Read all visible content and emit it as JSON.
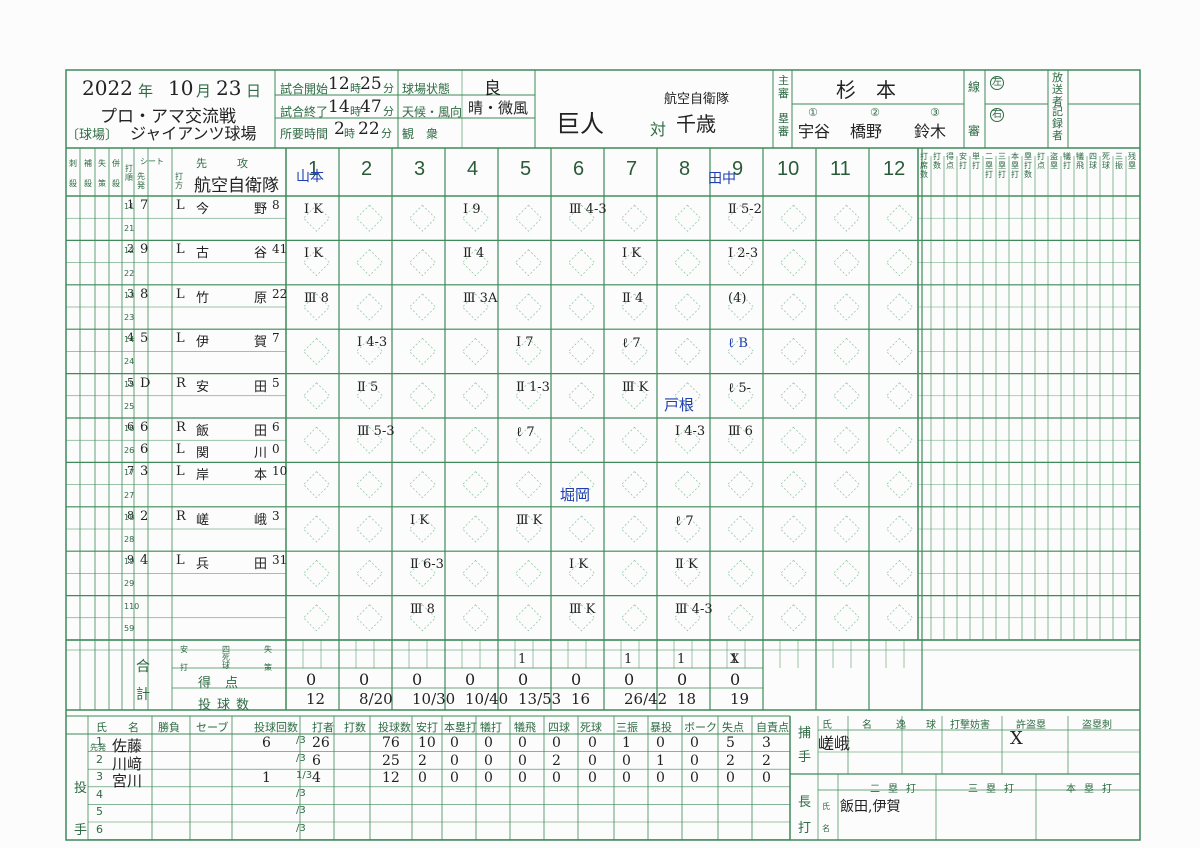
{
  "header": {
    "year": "2022",
    "year_unit": "年",
    "month": "10",
    "month_unit": "月",
    "day": "23",
    "day_unit": "日",
    "game_name": "プロ・アマ交流戦",
    "stadium_label": "〔球場〕",
    "stadium": "ジャイアンツ球場",
    "start_label": "試合開始",
    "start_h": "12",
    "hour_unit": "時",
    "start_m": "25",
    "min_unit": "分",
    "end_label": "試合終了",
    "end_h": "14",
    "end_m": "47",
    "dur_label": "所要時間",
    "dur_h": "2",
    "dur_m": "22",
    "field_cond_label": "球場状態",
    "field_cond": "良",
    "weather_label": "天候・風向",
    "weather": "晴・微風",
    "spectators_label": "観　衆",
    "home_team": "巨人",
    "vs": "対",
    "away_team": "千歳",
    "away_org": "航空自衛隊",
    "plate_ump_label": "主審",
    "plate_ump": "杉本",
    "base_ump_label": "塁審",
    "base_umps": [
      "宇谷",
      "橋野",
      "鈴木"
    ],
    "base_nums": [
      "①",
      "②",
      "③"
    ],
    "line_label": "線",
    "left": "左",
    "right": "右",
    "ump_label": "審",
    "broadcaster_label": "放送者",
    "recorder_label": "記録者"
  },
  "columns": {
    "stat_heads": [
      "刺",
      "補",
      "失",
      "併"
    ],
    "stat_heads2": [
      "殺",
      "殺",
      "策",
      "殺"
    ],
    "order_label": "打順",
    "seat_label": "シート",
    "seat_sub": [
      "先発"
    ],
    "team_label": "先攻",
    "batting_label": "打方",
    "right_heads": [
      "打席数",
      "打数",
      "得点",
      "安打",
      "単打",
      "二塁打",
      "三塁打",
      "本塁打",
      "塁打数",
      "打点",
      "盗塁",
      "犠打",
      "犠飛",
      "四球",
      "死球",
      "三振",
      "残塁"
    ],
    "innings": [
      "1",
      "2",
      "3",
      "4",
      "5",
      "6",
      "7",
      "8",
      "9",
      "10",
      "11",
      "12"
    ]
  },
  "lineup": [
    {
      "order": "1",
      "pos": "7",
      "bats": "L",
      "name": "今野",
      "num": "8"
    },
    {
      "order": "2",
      "pos": "9",
      "bats": "L",
      "name": "古谷",
      "num": "41"
    },
    {
      "order": "3",
      "pos": "8",
      "bats": "L",
      "name": "竹原",
      "num": "22"
    },
    {
      "order": "4",
      "pos": "5",
      "bats": "L",
      "name": "伊賀",
      "num": "7"
    },
    {
      "order": "5",
      "pos": "D",
      "bats": "R",
      "name": "安田",
      "num": "5"
    },
    {
      "order": "6",
      "pos": "6",
      "bats": "R",
      "name": "飯田",
      "num": "6"
    },
    {
      "order": "",
      "pos": "6",
      "bats": "L",
      "name": "関川",
      "num": "0"
    },
    {
      "order": "7",
      "pos": "3",
      "bats": "L",
      "name": "岸本",
      "num": "10"
    },
    {
      "order": "8",
      "pos": "2",
      "bats": "R",
      "name": "嵯峨",
      "num": "3"
    },
    {
      "order": "9",
      "pos": "4",
      "bats": "L",
      "name": "兵田",
      "num": "31"
    }
  ],
  "sub_rows": [
    "11",
    "21",
    "12",
    "22",
    "13",
    "23",
    "14",
    "24",
    "15",
    "25",
    "16",
    "26",
    "17",
    "27",
    "18",
    "28",
    "19",
    "29",
    "59"
  ],
  "pitcher_changes": [
    {
      "label": "山本",
      "inning": "1"
    },
    {
      "label": "田中",
      "inning": "9"
    },
    {
      "label": "戸根",
      "inning": "8"
    },
    {
      "label": "堀岡",
      "inning": "6"
    }
  ],
  "plays": [
    {
      "inn": 1,
      "row": 0,
      "text": "Ⅰ K"
    },
    {
      "inn": 1,
      "row": 1,
      "text": "Ⅰ K"
    },
    {
      "inn": 1,
      "row": 2,
      "text": "Ⅲ 8"
    },
    {
      "inn": 2,
      "row": 3,
      "text": "Ⅰ 4-3"
    },
    {
      "inn": 2,
      "row": 4,
      "text": "Ⅱ 5"
    },
    {
      "inn": 2,
      "row": 5,
      "text": "Ⅲ 5-3"
    },
    {
      "inn": 3,
      "row": 7,
      "text": "Ⅰ K"
    },
    {
      "inn": 3,
      "row": 8,
      "text": "Ⅱ 6-3"
    },
    {
      "inn": 3,
      "row": 9,
      "text": "Ⅲ 8"
    },
    {
      "inn": 4,
      "row": 0,
      "text": "Ⅰ 9"
    },
    {
      "inn": 4,
      "row": 1,
      "text": "Ⅱ 4"
    },
    {
      "inn": 4,
      "row": 2,
      "text": "Ⅲ 3A"
    },
    {
      "inn": 5,
      "row": 3,
      "text": "Ⅰ 7"
    },
    {
      "inn": 5,
      "row": 4,
      "text": "Ⅱ 1-3"
    },
    {
      "inn": 5,
      "row": 5,
      "text": "ℓ 7"
    },
    {
      "inn": 5,
      "row": 7,
      "text": "Ⅲ K"
    },
    {
      "inn": 6,
      "row": 0,
      "text": "Ⅲ 4-3"
    },
    {
      "inn": 6,
      "row": 8,
      "text": "Ⅰ K"
    },
    {
      "inn": 6,
      "row": 9,
      "text": "Ⅲ K"
    },
    {
      "inn": 7,
      "row": 1,
      "text": "Ⅰ K"
    },
    {
      "inn": 7,
      "row": 2,
      "text": "Ⅱ 4"
    },
    {
      "inn": 7,
      "row": 3,
      "text": "ℓ 7"
    },
    {
      "inn": 7,
      "row": 4,
      "text": "Ⅲ K"
    },
    {
      "inn": 8,
      "row": 5,
      "text": "Ⅰ 4-3"
    },
    {
      "inn": 8,
      "row": 7,
      "text": "ℓ 7"
    },
    {
      "inn": 8,
      "row": 8,
      "text": "Ⅱ K"
    },
    {
      "inn": 8,
      "row": 9,
      "text": "Ⅲ 4-3"
    },
    {
      "inn": 9,
      "row": 0,
      "text": "Ⅱ 5-2"
    },
    {
      "inn": 9,
      "row": 1,
      "text": "Ⅰ 2-3"
    },
    {
      "inn": 9,
      "row": 2,
      "text": "(4)"
    },
    {
      "inn": 9,
      "row": 3,
      "text": "ℓ B"
    },
    {
      "inn": 9,
      "row": 4,
      "text": "ℓ 5-"
    },
    {
      "inn": 9,
      "row": 5,
      "text": "Ⅲ 6"
    }
  ],
  "totals": {
    "label1": "合",
    "label2": "計",
    "sub_heads": [
      "安",
      "四",
      "失"
    ],
    "sub_heads2": [
      "打",
      "死球",
      "策"
    ],
    "runs_label": "得点",
    "pitches_label": "投球数",
    "hits": [
      "",
      "",
      "",
      "",
      "1",
      "",
      "1",
      "1",
      "1"
    ],
    "errors": [
      "",
      "",
      "",
      "",
      "",
      "",
      "",
      "",
      "X"
    ],
    "runs": [
      "0",
      "0",
      "0",
      "0",
      "0",
      "0",
      "0",
      "0",
      "0"
    ],
    "pitches": [
      "12",
      "8/20",
      "10/30",
      "10/40",
      "13/53",
      "16",
      "26/42",
      "18",
      "19"
    ]
  },
  "pitchers": {
    "heads": [
      "氏",
      "名",
      "勝負",
      "セーブ",
      "投球回数",
      "打者",
      "打数",
      "投球数",
      "安打",
      "本塁打",
      "犠打",
      "犠飛",
      "四球",
      "死球",
      "三振",
      "暴投",
      "ボーク",
      "失点",
      "自責点"
    ],
    "side_label": "投手",
    "first_label": "先発",
    "rows": [
      {
        "no": "1",
        "name": "佐藤",
        "win": "",
        "save": "",
        "ip_whole": "6",
        "ip_frac": "/3",
        "bf": "26",
        "ab": "",
        "np": "76",
        "h": "10",
        "hr": "0",
        "sh": "0",
        "sf": "0",
        "bb": "0",
        "hb": "0",
        "so": "1",
        "wp": "0",
        "bk": "0",
        "r": "5",
        "er": "3"
      },
      {
        "no": "2",
        "name": "川﨑",
        "win": "",
        "save": "",
        "ip_whole": "",
        "ip_frac": "/3",
        "bf": "6",
        "ab": "",
        "np": "25",
        "h": "2",
        "hr": "0",
        "sh": "0",
        "sf": "0",
        "bb": "2",
        "hb": "0",
        "so": "0",
        "wp": "1",
        "bk": "0",
        "r": "2",
        "er": "2"
      },
      {
        "no": "3",
        "name": "宮川",
        "win": "",
        "save": "",
        "ip_whole": "1",
        "ip_frac": "1/3",
        "bf": "4",
        "ab": "",
        "np": "12",
        "h": "0",
        "hr": "0",
        "sh": "0",
        "sf": "0",
        "bb": "0",
        "hb": "0",
        "so": "0",
        "wp": "0",
        "bk": "0",
        "r": "0",
        "er": "0"
      },
      {
        "no": "4",
        "name": "",
        "win": "",
        "save": "",
        "ip_whole": "",
        "ip_frac": "/3",
        "bf": "",
        "ab": "",
        "np": "",
        "h": "",
        "hr": "",
        "sh": "",
        "sf": "",
        "bb": "",
        "hb": "",
        "so": "",
        "wp": "",
        "bk": "",
        "r": "",
        "er": ""
      },
      {
        "no": "5",
        "name": "",
        "win": "",
        "save": "",
        "ip_whole": "",
        "ip_frac": "/3",
        "bf": "",
        "ab": "",
        "np": "",
        "h": "",
        "hr": "",
        "sh": "",
        "sf": "",
        "bb": "",
        "hb": "",
        "so": "",
        "wp": "",
        "bk": "",
        "r": "",
        "er": ""
      },
      {
        "no": "6",
        "name": "",
        "win": "",
        "save": "",
        "ip_whole": "",
        "ip_frac": "/3",
        "bf": "",
        "ab": "",
        "np": "",
        "h": "",
        "hr": "",
        "sh": "",
        "sf": "",
        "bb": "",
        "hb": "",
        "so": "",
        "wp": "",
        "bk": "",
        "r": "",
        "er": ""
      }
    ]
  },
  "catchers": {
    "side_label": "捕手",
    "heads": [
      "氏",
      "名",
      "逸",
      "球",
      "打撃妨害",
      "許盗塁",
      "盗塁刺"
    ],
    "name": "嵯峨",
    "allowed_steal": "X"
  },
  "extra_hits": {
    "side_label": "長打",
    "heads": [
      "二塁打",
      "三塁打",
      "本塁打"
    ],
    "name_label": "氏名",
    "doubles": "飯田,伊賀"
  }
}
